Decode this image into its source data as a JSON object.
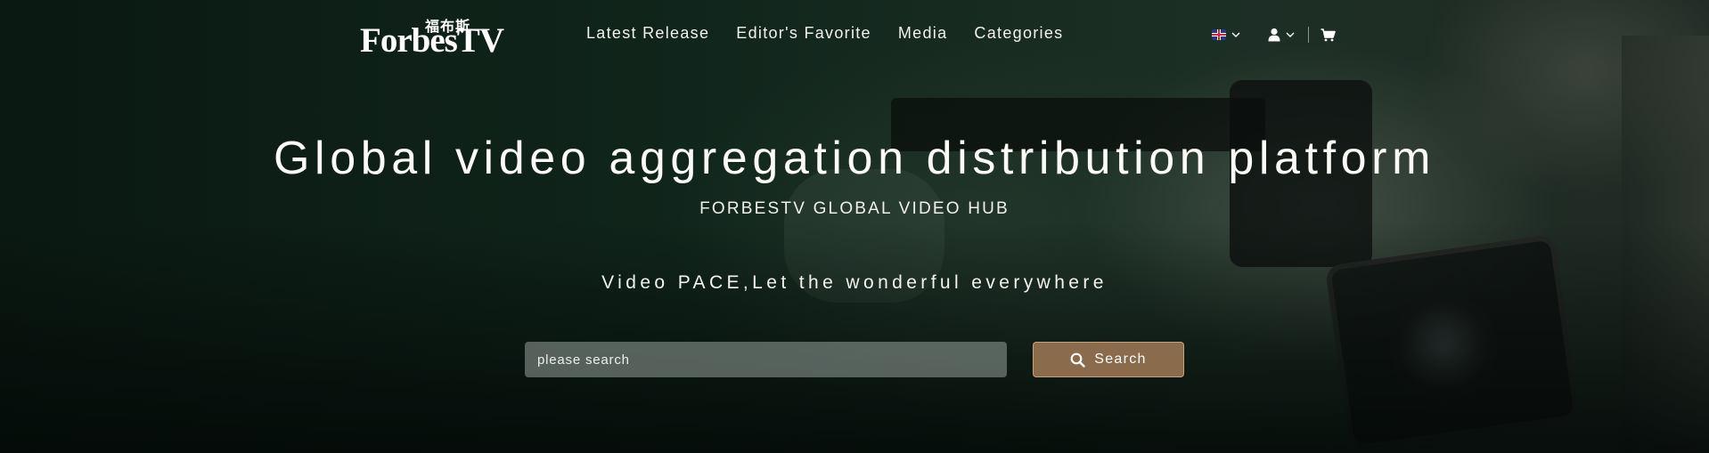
{
  "brand": {
    "logo_main": "ForbesTV",
    "logo_cn": "福布斯"
  },
  "nav": {
    "items": [
      {
        "label": "Latest Release"
      },
      {
        "label": "Editor's Favorite"
      },
      {
        "label": "Media"
      },
      {
        "label": "Categories"
      }
    ]
  },
  "toolbar": {
    "language_icon": "uk-flag-icon",
    "user_icon": "user-icon",
    "cart_icon": "cart-icon"
  },
  "hero": {
    "title": "Global video aggregation distribution platform",
    "subtitle": "FORBESTV GLOBAL VIDEO HUB",
    "tagline": "Video PACE,Let the wonderful everywhere"
  },
  "search": {
    "placeholder": "please search",
    "value": "",
    "button_label": "Search",
    "button_icon": "search-icon"
  },
  "colors": {
    "accent": "#8a6b4b",
    "accent_border": "#c9a47a",
    "input_bg": "#7d8782"
  }
}
